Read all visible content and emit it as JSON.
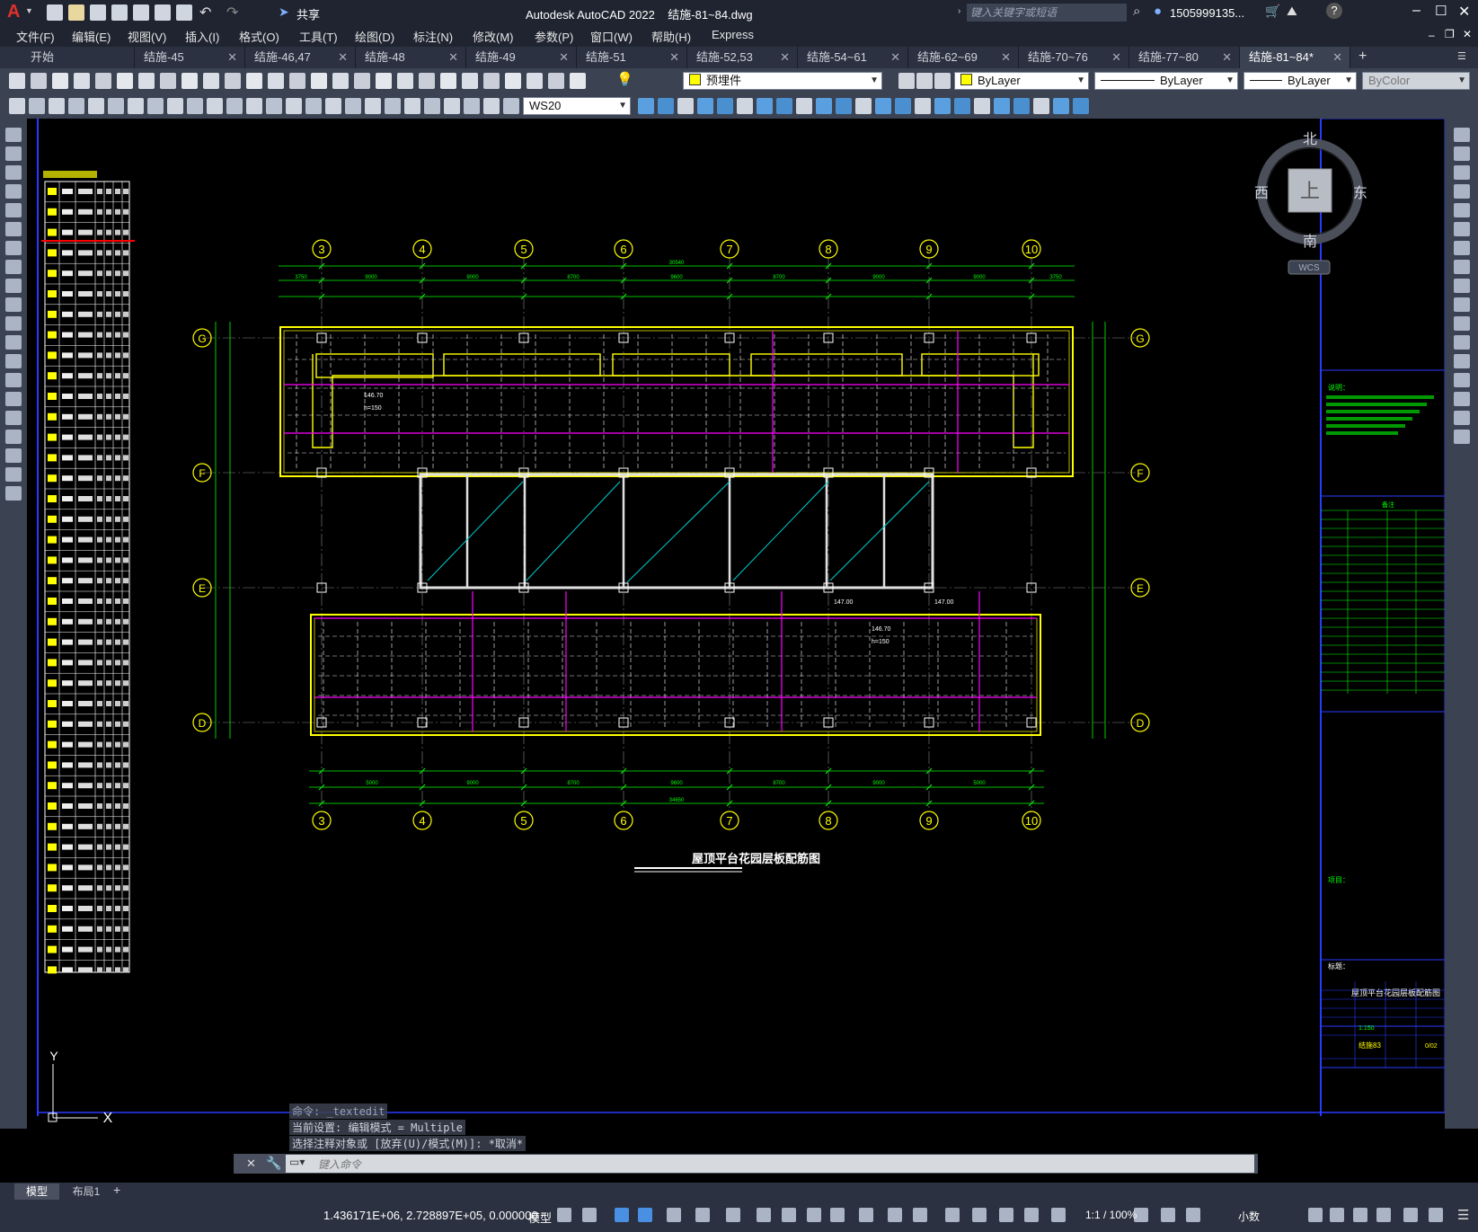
{
  "title_bar": {
    "app_logo": "A",
    "share_label": "共享",
    "title": "Autodesk AutoCAD 2022    结施-81~84.dwg",
    "search_placeholder": "键入关键字或短语",
    "user": "1505999135...",
    "icons": [
      "new-icon",
      "open-icon",
      "save-icon",
      "saveas-icon",
      "print-icon",
      "undo-icon",
      "redo-icon"
    ]
  },
  "menu": [
    "文件(F)",
    "编辑(E)",
    "视图(V)",
    "插入(I)",
    "格式(O)",
    "工具(T)",
    "绘图(D)",
    "标注(N)",
    "修改(M)",
    "参数(P)",
    "窗口(W)",
    "帮助(H)",
    "Express"
  ],
  "tabs": [
    {
      "label": "开始"
    },
    {
      "label": "结施-45"
    },
    {
      "label": "结施-46,47"
    },
    {
      "label": "结施-48"
    },
    {
      "label": "结施-49"
    },
    {
      "label": "结施-51"
    },
    {
      "label": "结施-52,53"
    },
    {
      "label": "结施-54~61"
    },
    {
      "label": "结施-62~69"
    },
    {
      "label": "结施-70~76"
    },
    {
      "label": "结施-77~80"
    },
    {
      "label": "结施-81~84*"
    }
  ],
  "toolbar": {
    "layer": "预埋件",
    "color": "ByLayer",
    "linetype": "ByLayer",
    "lineweight": "ByLayer",
    "plotstyle": "ByColor",
    "ucs": "WS20"
  },
  "drawing": {
    "title": "屋顶平台花园层板配筋图",
    "grid_columns": [
      "3",
      "4",
      "5",
      "6",
      "7",
      "8",
      "9",
      "10"
    ],
    "grid_rows": [
      "G",
      "F",
      "E",
      "D"
    ],
    "overall_dim_top": "30540",
    "overall_dim_bottom": "34650",
    "top_dims": [
      "3750",
      "9000",
      "9000",
      "8700",
      "9600",
      "8700",
      "9000",
      "9000",
      "3750"
    ],
    "bottom_dims": [
      "5000",
      "9000",
      "8700",
      "9600",
      "8700",
      "9000",
      "5000"
    ],
    "notes_labels": [
      "146.70",
      "h=150",
      "147.00",
      "146.70",
      "h=150",
      "147.00"
    ]
  },
  "viewcube": {
    "north": "北",
    "south": "南",
    "east": "东",
    "west": "西",
    "top": "上",
    "wcs": "WCS"
  },
  "title_block": {
    "header": "说明：",
    "remarks_title": "备注",
    "project_label": "项目：",
    "drawing_name_label": "标题：",
    "drawing_name": "屋顶平台花园层板配筋图",
    "sheet_no": "结施83",
    "scale": "1:150",
    "page": "0/02"
  },
  "command": {
    "line1": "命令: _textedit",
    "line2": "当前设置: 编辑模式 = Multiple",
    "line3": "选择注释对象或 [放弃(U)/模式(M)]: *取消*",
    "input_placeholder": "键入命令"
  },
  "layout_tabs": [
    "模型",
    "布局1"
  ],
  "status": {
    "coords": "1.436171E+06, 2.728897E+05, 0.000000",
    "mode": "模型",
    "scale": "1:1 / 100%",
    "units": "小数"
  },
  "axis_labels": {
    "x": "X",
    "y": "Y"
  }
}
